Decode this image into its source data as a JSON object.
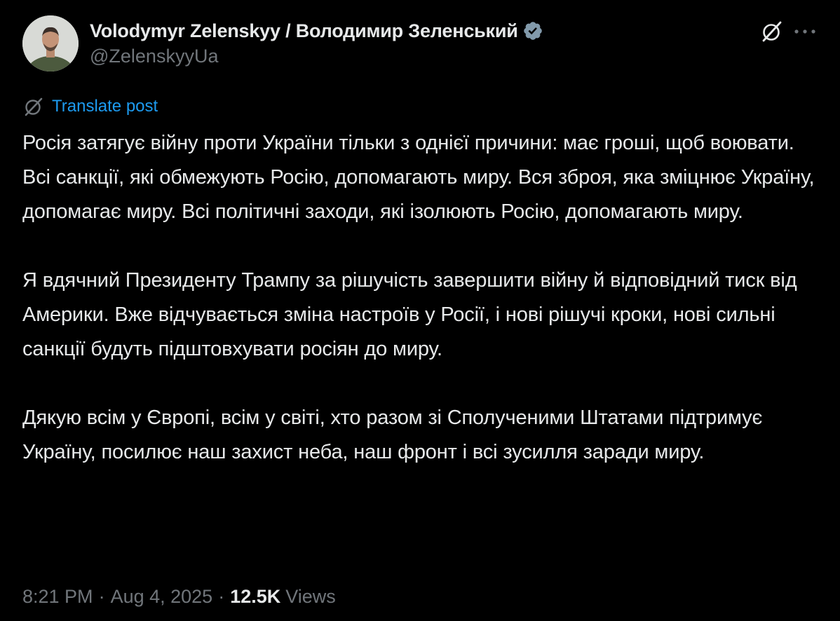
{
  "author": {
    "display_name": "Volodymyr Zelenskyy / Володимир Зеленський",
    "handle": "@ZelenskyyUa",
    "verified_icon": "verified-badge-icon",
    "avatar": "avatar"
  },
  "header_actions": {
    "grok_icon": "grok-icon",
    "more_icon": "more-icon"
  },
  "translate": {
    "icon": "translate-icon",
    "label": "Translate post"
  },
  "tweet": {
    "paragraphs": [
      "Росія затягує війну проти України тільки з однієї причини: має гроші, щоб воювати. Всі санкції, які обмежують Росію, допомагають миру. Вся зброя, яка зміцнює Україну, допомагає миру. Всі політичні заходи, які ізолюють Росію, допомагають миру.",
      "Я вдячний Президенту Трампу за рішучість завершити війну й відповідний тиск від Америки. Вже відчувається зміна настроїв у Росії, і нові рішучі кроки, нові сильні санкції будуть підштовхувати росіян до миру.",
      "Дякую всім у Європі, всім у світі, хто разом зі Сполученими Штатами підтримує Україну, посилює наш захист неба, наш фронт і всі зусилля заради миру."
    ]
  },
  "meta": {
    "time": "8:21 PM",
    "separator": "·",
    "date": "Aug 4, 2025",
    "views_count": "12.5K",
    "views_label": "Views"
  },
  "colors": {
    "background": "#000000",
    "text_primary": "#e7e9ea",
    "text_secondary": "#71767b",
    "accent": "#1d9bf0",
    "verified_badge": "#829aab"
  }
}
